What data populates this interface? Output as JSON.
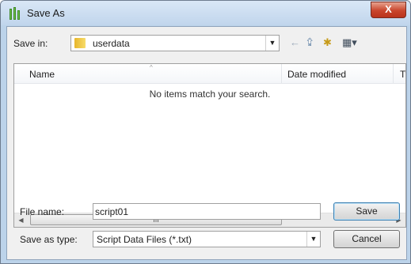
{
  "window": {
    "title": "Save As",
    "close_symbol": "X"
  },
  "toolbar": {
    "save_in_label": "Save in:",
    "save_in_value": "userdata",
    "back_icon": "←",
    "up_icon": "⮸",
    "new_folder_icon": "✱",
    "views_icon": "▦▾"
  },
  "list": {
    "columns": [
      "Name",
      "Date modified",
      "Ty"
    ],
    "empty_message": "No items match your search.",
    "scroll_grip": "III"
  },
  "form": {
    "file_name_label": "File name:",
    "file_name_value": "script01",
    "save_as_type_label": "Save as type:",
    "save_as_type_value": "Script Data Files (*.txt)"
  },
  "buttons": {
    "save": "Save",
    "cancel": "Cancel"
  }
}
